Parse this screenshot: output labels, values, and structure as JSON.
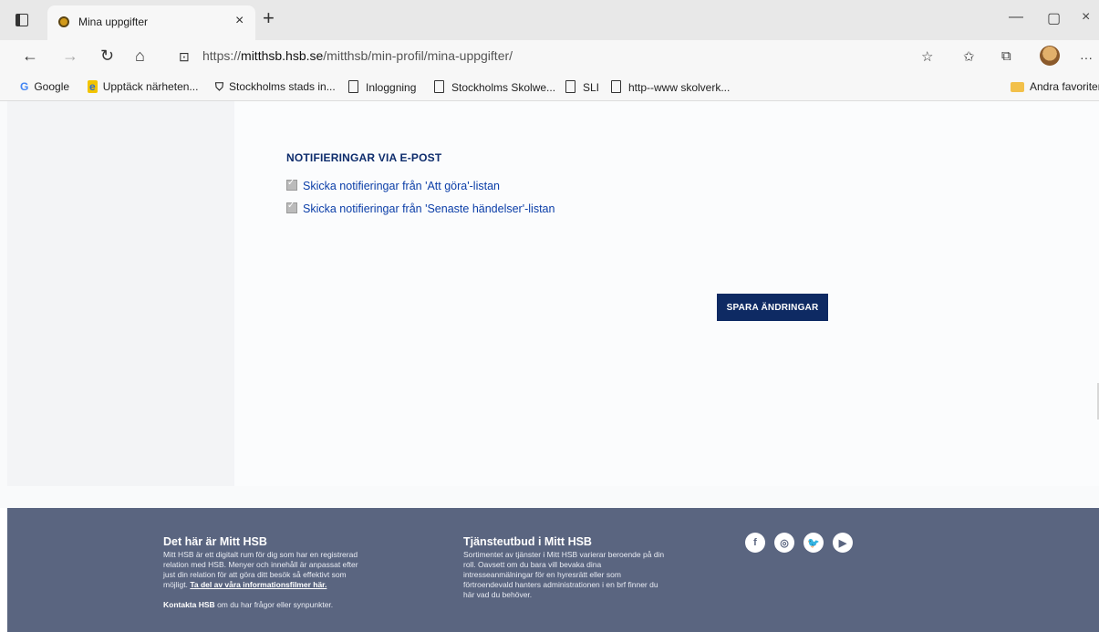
{
  "browser": {
    "tab_title": "Mina uppgifter",
    "tab_close": "×",
    "new_tab": "+",
    "url_prefix": "https://",
    "url_host": "mitthsb.hsb.se",
    "url_path": "/mitthsb/min-profil/mina-uppgifter/",
    "more": "···",
    "window_controls": {
      "minimize": "—",
      "maximize": "▢",
      "close": "×"
    }
  },
  "bookmarks": [
    {
      "label": "Google",
      "icon": "google-icon"
    },
    {
      "label": "Upptäck närheten...",
      "icon": "upptack-icon"
    },
    {
      "label": "Stockholms stads in...",
      "icon": "shield-icon"
    },
    {
      "label": "Inloggning",
      "icon": "document-icon"
    },
    {
      "label": "Stockholms Skolwe...",
      "icon": "document-icon"
    },
    {
      "label": "SLI",
      "icon": "document-icon"
    },
    {
      "label": "http--www skolverk...",
      "icon": "document-icon"
    }
  ],
  "other_favorites": "Andra favoriter",
  "notifications": {
    "title": "NOTIFIERINGAR VIA E-POST",
    "options": [
      {
        "label": "Skicka notifieringar från 'Att göra'-listan",
        "checked": true
      },
      {
        "label": "Skicka notifieringar från 'Senaste händelser'-listan",
        "checked": true
      }
    ],
    "save_label": "SPARA ÄNDRINGAR"
  },
  "footer": {
    "col1": {
      "title": "Det här är Mitt HSB",
      "line1": "Mitt HSB är ett digitalt rum för dig som har en registrerad",
      "line2": "relation med HSB. Menyer och innehåll är anpassat efter",
      "line3": "just din relation för att göra ditt besök så effektivt som",
      "line4": "möjligt.",
      "link": "Ta del av våra informationsfilmer här.",
      "contact_link": "Kontakta HSB",
      "contact_text": "om du har frågor eller synpunkter."
    },
    "col2": {
      "title": "Tjänsteutbud i Mitt HSB",
      "line1": "Sortimentet av tjänster i Mitt HSB varierar beroende på din",
      "line2": "roll. Oavsett om du bara vill bevaka dina",
      "line3": "intresseanmälningar för en hyresrätt eller som",
      "line4": "förtroendevald hanters administrationen i en brf finner du",
      "line5": "här vad du behöver."
    },
    "social": [
      "facebook-icon",
      "instagram-icon",
      "twitter-icon",
      "youtube-icon"
    ]
  },
  "colors": {
    "navy": "#0e2a63",
    "footer": "#5a6580",
    "link": "#0b3ea8"
  }
}
